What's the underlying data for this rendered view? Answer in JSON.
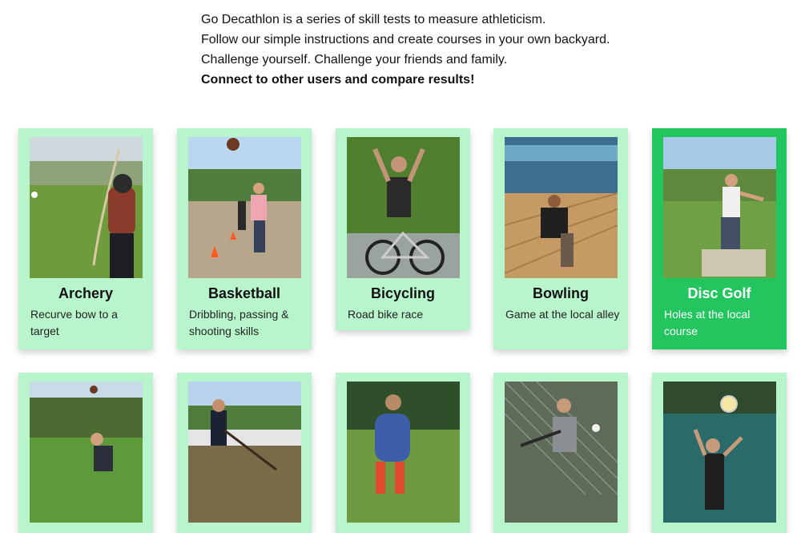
{
  "intro": {
    "line1": "Go Decathlon is a series of skill tests to measure athleticism.",
    "line2": "Follow our simple instructions and create courses in your own backyard.",
    "line3": "Challenge yourself. Challenge your friends and family.",
    "line4": "Connect to other users and compare results!"
  },
  "cards": [
    {
      "title": "Archery",
      "desc": "Recurve bow to a target",
      "photo": "archer-photo",
      "active": false
    },
    {
      "title": "Basketball",
      "desc": "Dribbling, passing & shooting skills",
      "photo": "basketball-photo",
      "active": false
    },
    {
      "title": "Bicycling",
      "desc": "Road bike race",
      "photo": "bicycling-photo",
      "active": false
    },
    {
      "title": "Bowling",
      "desc": "Game at the local alley",
      "photo": "bowling-photo",
      "active": false
    },
    {
      "title": "Disc Golf",
      "desc": "Holes at the local course",
      "photo": "disc-golf-photo",
      "active": true
    },
    {
      "title": "",
      "desc": "",
      "photo": "throwing-photo",
      "active": false
    },
    {
      "title": "",
      "desc": "",
      "photo": "hockey-photo",
      "active": false
    },
    {
      "title": "",
      "desc": "",
      "photo": "kicking-photo",
      "active": false
    },
    {
      "title": "",
      "desc": "",
      "photo": "baseball-photo",
      "active": false
    },
    {
      "title": "",
      "desc": "",
      "photo": "volleyball-photo",
      "active": false
    }
  ],
  "colors": {
    "card": "#b8f5cc",
    "card_active": "#22c55e"
  }
}
